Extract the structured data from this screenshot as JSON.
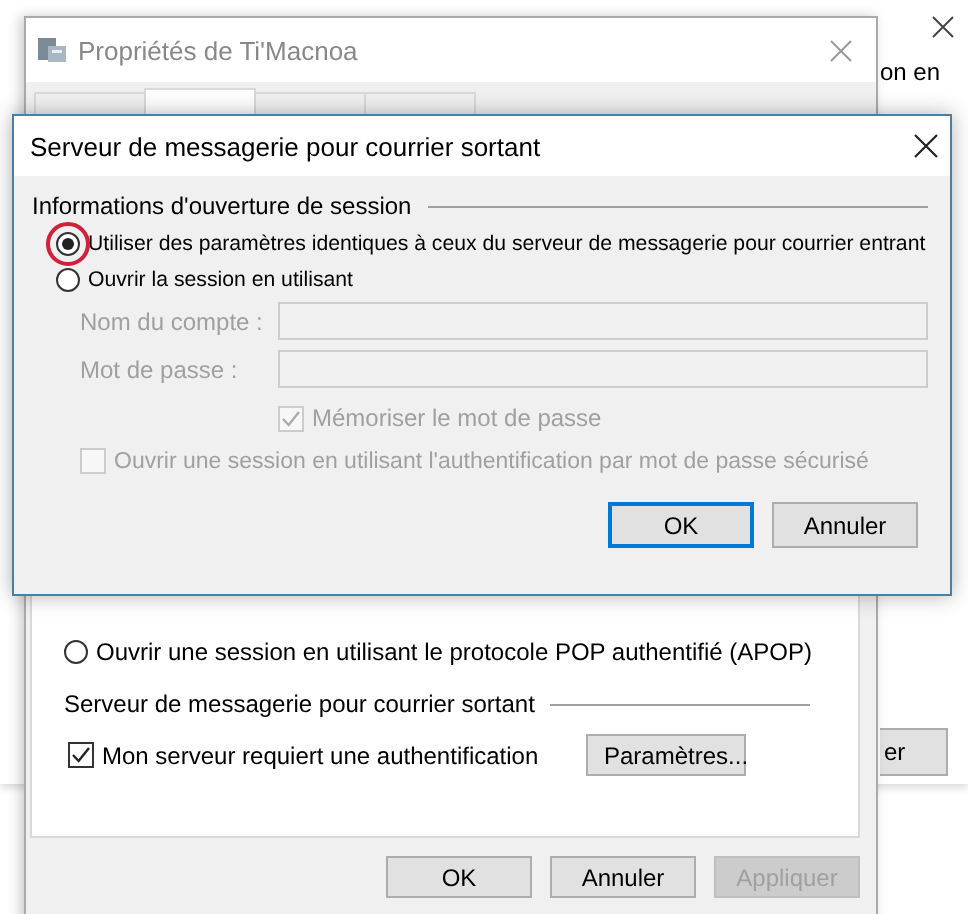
{
  "background_window": {
    "text_fragment": "on en",
    "button_fragment": "er"
  },
  "properties_window": {
    "title": "Propriétés de Ti'Macnoa",
    "tabs": [
      {
        "selected": false
      },
      {
        "selected": true
      },
      {
        "selected": false
      },
      {
        "selected": false
      }
    ],
    "apop_option": {
      "label": "Ouvrir une session en utilisant le protocole POP authentifié (APOP)",
      "selected": false
    },
    "outgoing_group": {
      "label": "Serveur de messagerie pour courrier sortant",
      "requires_auth": {
        "label": "Mon serveur requiert une authentification",
        "checked": true
      },
      "settings_button": "Paramètres..."
    },
    "buttons": [
      {
        "label": "OK",
        "disabled": false
      },
      {
        "label": "Annuler",
        "disabled": false
      },
      {
        "label": "Appliquer",
        "disabled": true
      }
    ]
  },
  "dialog": {
    "title": "Serveur de messagerie pour courrier sortant",
    "group_label": "Informations d'ouverture de session",
    "options": [
      {
        "label": "Utiliser des paramètres identiques à ceux du serveur de messagerie pour courrier entrant",
        "selected": true,
        "annotated": true
      },
      {
        "label": "Ouvrir la session en utilisant",
        "selected": false,
        "annotated": false
      }
    ],
    "fields": [
      {
        "label": "Nom du compte :",
        "disabled": true
      },
      {
        "label": "Mot de passe :",
        "disabled": true
      }
    ],
    "remember_password": {
      "label": "Mémoriser le mot de passe",
      "checked": true,
      "disabled": true
    },
    "spa": {
      "label": "Ouvrir une session en utilisant l'authentification par mot de passe sécurisé",
      "checked": false,
      "disabled": true
    },
    "buttons": [
      {
        "label": "OK",
        "focused": true
      },
      {
        "label": "Annuler",
        "focused": false
      }
    ]
  }
}
